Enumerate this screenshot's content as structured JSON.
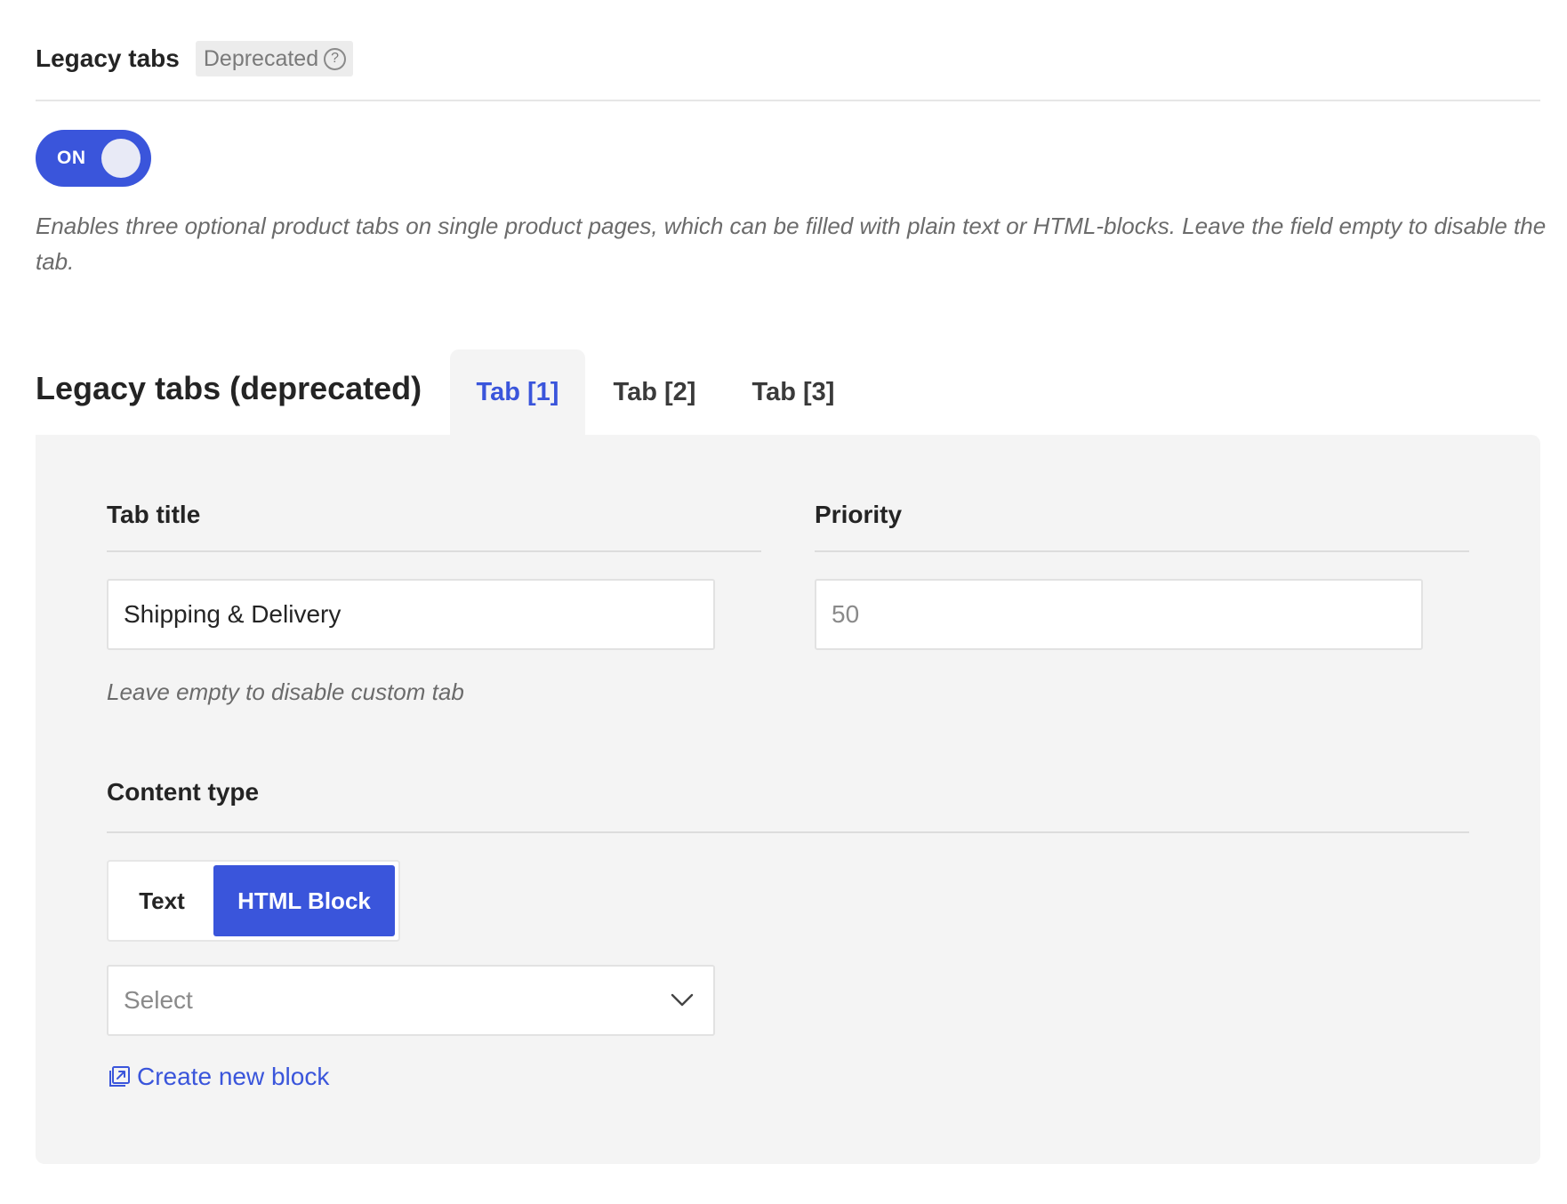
{
  "header": {
    "title": "Legacy tabs",
    "badge": "Deprecated",
    "help_icon": "question-circle-icon"
  },
  "toggle": {
    "label": "ON",
    "state": "on"
  },
  "description": "Enables three optional product tabs on single product pages, which can be filled with plain text or HTML-blocks. Leave the field empty to disable the tab.",
  "section": {
    "title": "Legacy tabs (deprecated)",
    "tabs": [
      {
        "label": "Tab [1]",
        "active": true
      },
      {
        "label": "Tab [2]",
        "active": false
      },
      {
        "label": "Tab [3]",
        "active": false
      }
    ]
  },
  "form": {
    "tab_title": {
      "label": "Tab title",
      "value": "Shipping & Delivery",
      "hint": "Leave empty to disable custom tab"
    },
    "priority": {
      "label": "Priority",
      "placeholder": "50"
    },
    "content_type": {
      "label": "Content type",
      "options": [
        "Text",
        "HTML Block"
      ],
      "selected": "HTML Block"
    },
    "block_select": {
      "value": "Select",
      "icon": "chevron-down-icon"
    },
    "create_link": {
      "label": "Create new block",
      "icon": "external-link-icon"
    }
  },
  "colors": {
    "accent": "#3a55db",
    "panel_bg": "#f4f4f4",
    "muted_text": "#6b6b6b"
  }
}
